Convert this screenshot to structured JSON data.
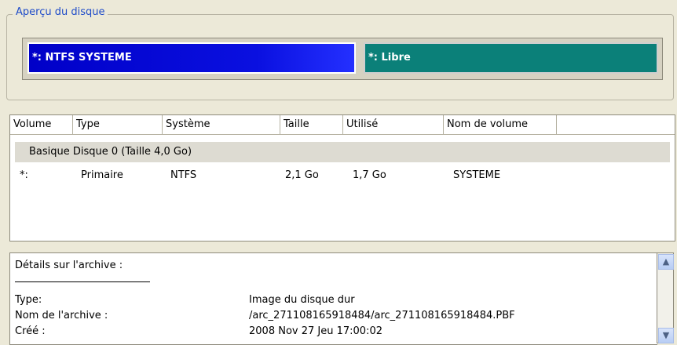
{
  "overview": {
    "title": "Aperçu du disque",
    "partitions": [
      {
        "label": "*: NTFS SYSTEME",
        "color": "#0a10e0"
      },
      {
        "label": "*: Libre",
        "color": "#0b8079"
      }
    ]
  },
  "table": {
    "columns": [
      "Volume",
      "Type",
      "Système",
      "Taille",
      "Utilisé",
      "Nom de volume"
    ],
    "group_label": "Basique Disque 0 (Taille 4,0 Go)",
    "rows": [
      {
        "volume": "*:",
        "type": "Primaire",
        "system": "NTFS",
        "size": "2,1 Go",
        "used": "1,7 Go",
        "name": "SYSTEME"
      }
    ]
  },
  "details": {
    "title": "Détails sur l'archive :",
    "fields": [
      {
        "label": "Type:",
        "value": "Image du disque dur"
      },
      {
        "label": "Nom de l'archive :",
        "value": "/arc_271108165918484/arc_271108165918484.PBF"
      },
      {
        "label": "Créé :",
        "value": "2008 Nov 27 Jeu 17:00:02"
      }
    ]
  },
  "scrollbar": {
    "up_icon": "chevron-up-icon",
    "down_icon": "chevron-down-icon"
  }
}
